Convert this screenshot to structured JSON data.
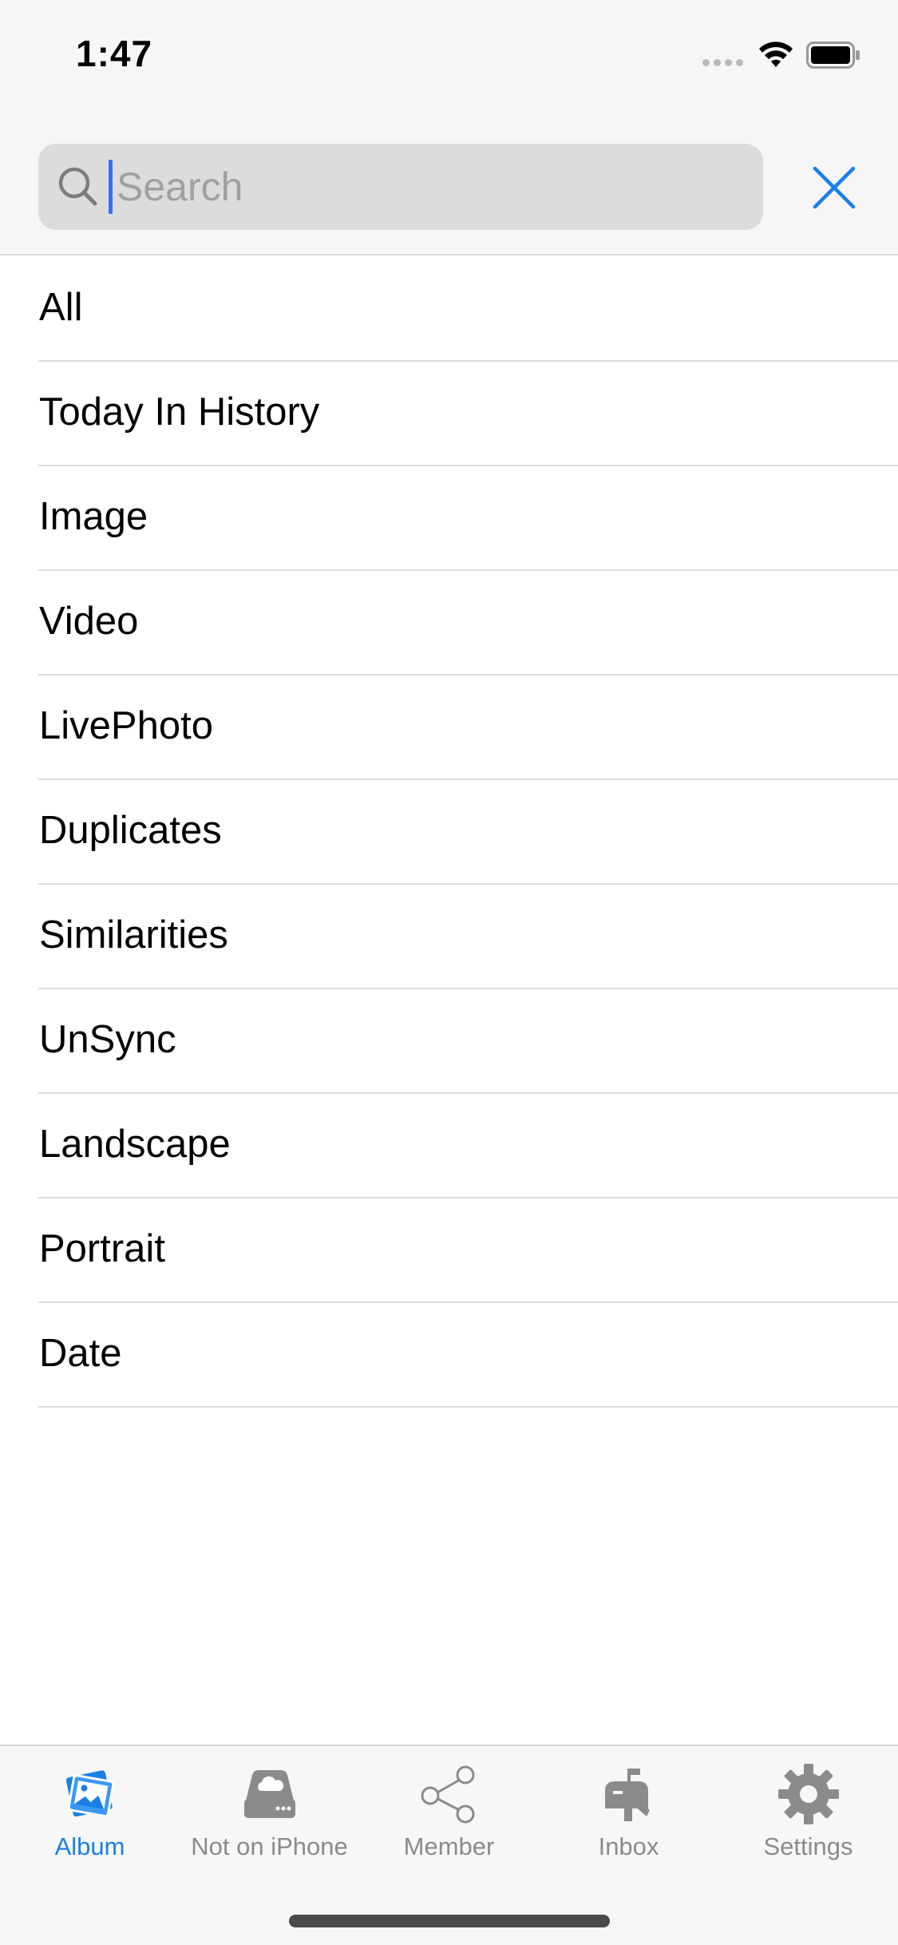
{
  "status_bar": {
    "time": "1:47"
  },
  "search": {
    "placeholder": "Search",
    "value": ""
  },
  "colors": {
    "accent": "#1a7fe6",
    "caret": "#3a6ff2",
    "tab_inactive": "#8b8b8b"
  },
  "list": {
    "items": [
      {
        "label": "All"
      },
      {
        "label": "Today In History"
      },
      {
        "label": "Image"
      },
      {
        "label": "Video"
      },
      {
        "label": "LivePhoto"
      },
      {
        "label": "Duplicates"
      },
      {
        "label": "Similarities"
      },
      {
        "label": "UnSync"
      },
      {
        "label": "Landscape"
      },
      {
        "label": "Portrait"
      },
      {
        "label": "Date"
      }
    ]
  },
  "tab_bar": {
    "tabs": [
      {
        "label": "Album",
        "icon": "album-icon",
        "active": true
      },
      {
        "label": "Not on iPhone",
        "icon": "cloud-drive-icon",
        "active": false
      },
      {
        "label": "Member",
        "icon": "share-icon",
        "active": false
      },
      {
        "label": "Inbox",
        "icon": "mailbox-icon",
        "active": false
      },
      {
        "label": "Settings",
        "icon": "gear-icon",
        "active": false
      }
    ]
  }
}
